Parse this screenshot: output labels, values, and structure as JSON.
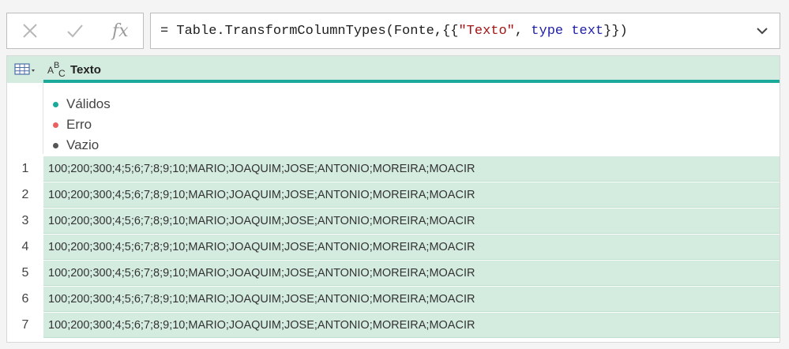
{
  "formula_bar": {
    "prefix": "= Table.TransformColumnTypes(Fonte,{{",
    "string_literal": "\"Texto\"",
    "separator": ", ",
    "keyword_type": "type",
    "space": " ",
    "keyword_text": "text",
    "suffix": "}})",
    "fx_label": "fx"
  },
  "grid": {
    "column": {
      "type_icon": "abc-text-type-icon",
      "name": "Texto",
      "header_color": "#d4ecdf",
      "accent_color": "#1baa9a"
    },
    "profile": [
      {
        "label": "Válidos",
        "color": "#1baa9a"
      },
      {
        "label": "Erro",
        "color": "#e86060"
      },
      {
        "label": "Vazio",
        "color": "#555555"
      }
    ],
    "rows": [
      {
        "num": "1",
        "value": "100;200;300;4;5;6;7;8;9;10;MARIO;JOAQUIM;JOSE;ANTONIO;MOREIRA;MOACIR"
      },
      {
        "num": "2",
        "value": "100;200;300;4;5;6;7;8;9;10;MARIO;JOAQUIM;JOSE;ANTONIO;MOREIRA;MOACIR"
      },
      {
        "num": "3",
        "value": "100;200;300;4;5;6;7;8;9;10;MARIO;JOAQUIM;JOSE;ANTONIO;MOREIRA;MOACIR"
      },
      {
        "num": "4",
        "value": "100;200;300;4;5;6;7;8;9;10;MARIO;JOAQUIM;JOSE;ANTONIO;MOREIRA;MOACIR"
      },
      {
        "num": "5",
        "value": "100;200;300;4;5;6;7;8;9;10;MARIO;JOAQUIM;JOSE;ANTONIO;MOREIRA;MOACIR"
      },
      {
        "num": "6",
        "value": "100;200;300;4;5;6;7;8;9;10;MARIO;JOAQUIM;JOSE;ANTONIO;MOREIRA;MOACIR"
      },
      {
        "num": "7",
        "value": "100;200;300;4;5;6;7;8;9;10;MARIO;JOAQUIM;JOSE;ANTONIO;MOREIRA;MOACIR"
      }
    ]
  }
}
